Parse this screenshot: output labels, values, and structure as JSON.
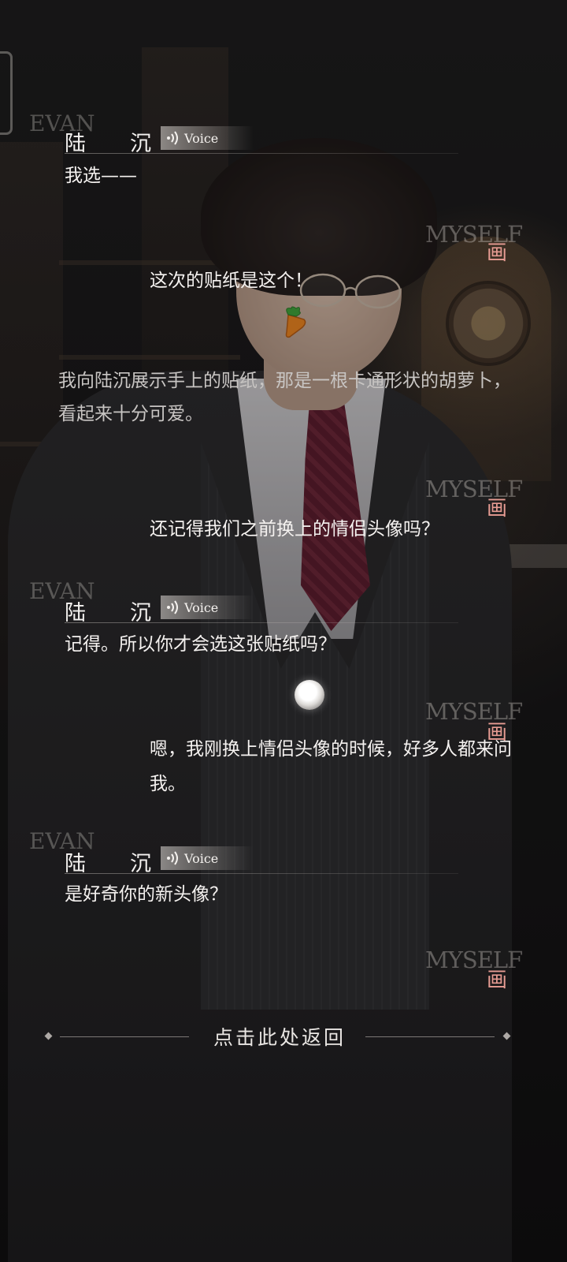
{
  "log": {
    "entries": [
      {
        "speaker": "陆沉",
        "voice": "Voice",
        "text": "我选——"
      },
      {
        "player_text": "这次的贴纸是这个！"
      },
      {
        "narration": "我向陆沉展示手上的贴纸，那是一根卡通形状的胡萝卜，看起来十分可爱。"
      },
      {
        "player_text": "还记得我们之前换上的情侣头像吗？"
      },
      {
        "speaker": "陆沉",
        "voice": "Voice",
        "text": "记得。所以你才会选这张贴纸吗？"
      },
      {
        "player_text": "嗯，我刚换上情侣头像的时候，好多人都来问我。"
      },
      {
        "speaker": "陆沉",
        "voice": "Voice",
        "text": "是好奇你的新头像？"
      }
    ]
  },
  "speaker_chars": [
    "陆",
    "沉"
  ],
  "watermarks": {
    "myself": "MYSELF",
    "hua": "画",
    "evan": "EVAN"
  },
  "return_button": {
    "label": "点击此处返回"
  },
  "colors": {
    "watermark_accent": "#e79c93",
    "text": "#f5f2f0",
    "narration": "#c8c5c3"
  }
}
